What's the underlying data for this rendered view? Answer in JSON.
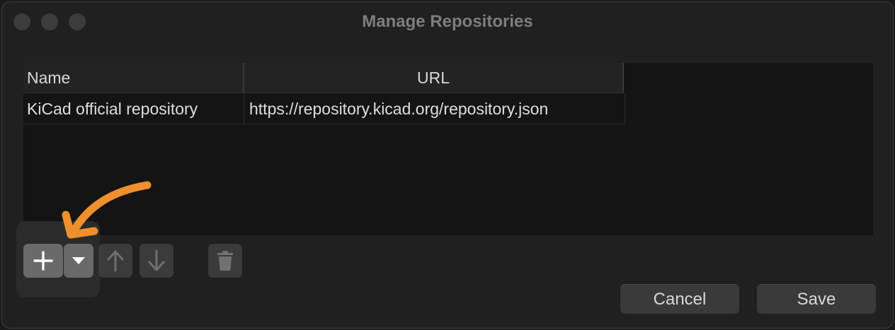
{
  "window": {
    "title": "Manage Repositories"
  },
  "table": {
    "columns": [
      "Name",
      "URL"
    ],
    "rows": [
      {
        "name": "KiCad official repository",
        "url": "https://repository.kicad.org/repository.json"
      }
    ]
  },
  "toolbar": {
    "add_icon": "plus-icon",
    "dropdown_icon": "triangle-down-icon",
    "move_up_icon": "arrow-up-icon",
    "move_down_icon": "arrow-down-icon",
    "delete_icon": "trash-icon"
  },
  "buttons": {
    "cancel_label": "Cancel",
    "save_label": "Save"
  },
  "annotation": {
    "color": "#f0902c",
    "icon": "curved-arrow-icon"
  }
}
